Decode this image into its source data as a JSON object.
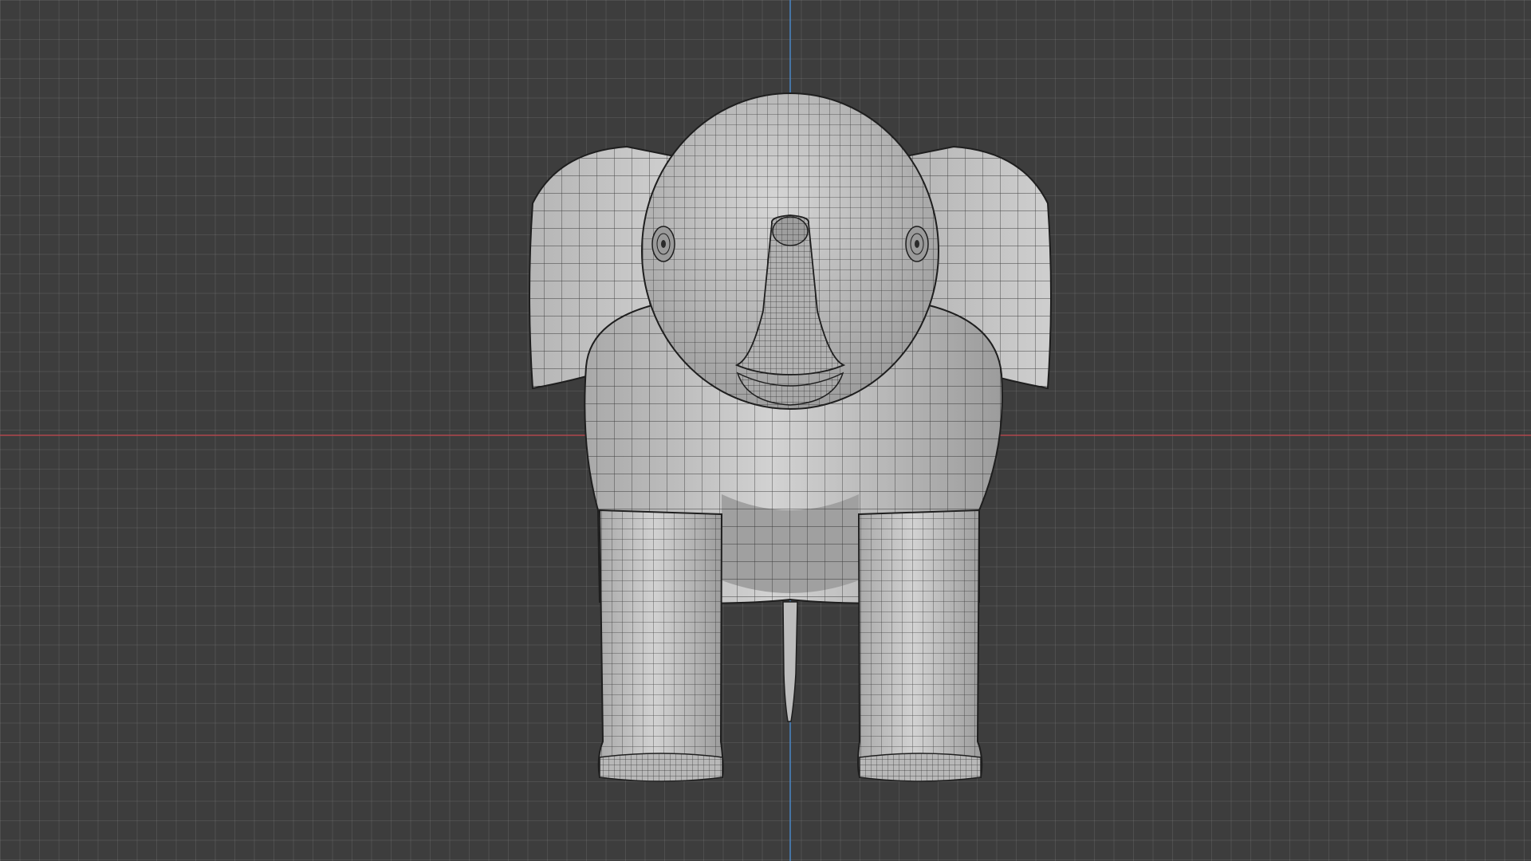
{
  "viewport": {
    "mode": "3D viewport",
    "view": "front-orthographic",
    "shading": "solid-wireframe-overlay",
    "grid": true,
    "background_color": "#3d3d3d",
    "grid_color": "#4b4b4b",
    "x_axis_color": "#b0464d",
    "z_axis_color": "#4a86c6"
  },
  "object": {
    "name_semantic": "elephant-mesh",
    "mesh_color": "#c8c8c8",
    "wire_color": "#1e1e1e"
  }
}
